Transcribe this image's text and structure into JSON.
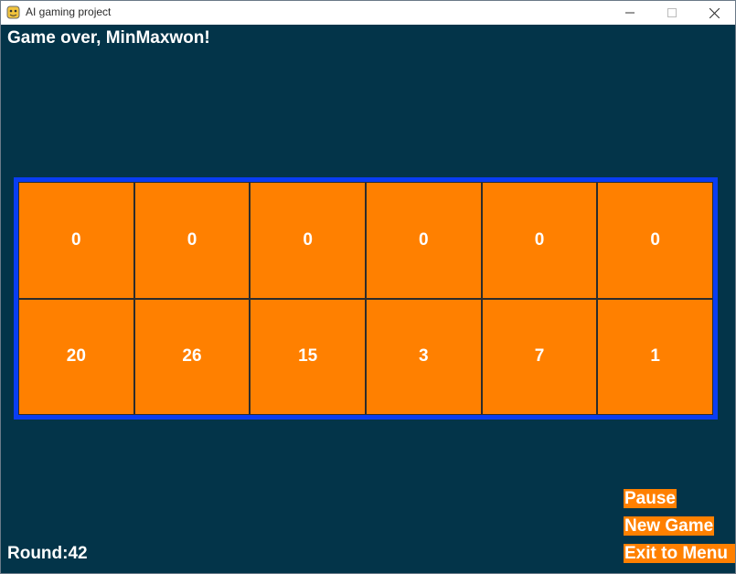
{
  "window": {
    "title": "AI gaming project",
    "controls": {
      "minimize_icon": "minimize-icon",
      "maximize_icon": "maximize-icon",
      "close_icon": "close-icon"
    }
  },
  "game": {
    "status": "Game over, MinMaxwon!",
    "round": "Round:42",
    "board": {
      "top_row": [
        "0",
        "0",
        "0",
        "0",
        "0",
        "0"
      ],
      "bottom_row": [
        "20",
        "26",
        "15",
        "3",
        "7",
        "1"
      ]
    },
    "menu": {
      "pause_label": "Pause",
      "new_game_label": "New Game",
      "exit_label": "Exit to Menu"
    }
  },
  "colors": {
    "background": "#033449",
    "board_border": "#0a3df2",
    "pit_fill": "#ff8000",
    "text": "#ffffff"
  }
}
